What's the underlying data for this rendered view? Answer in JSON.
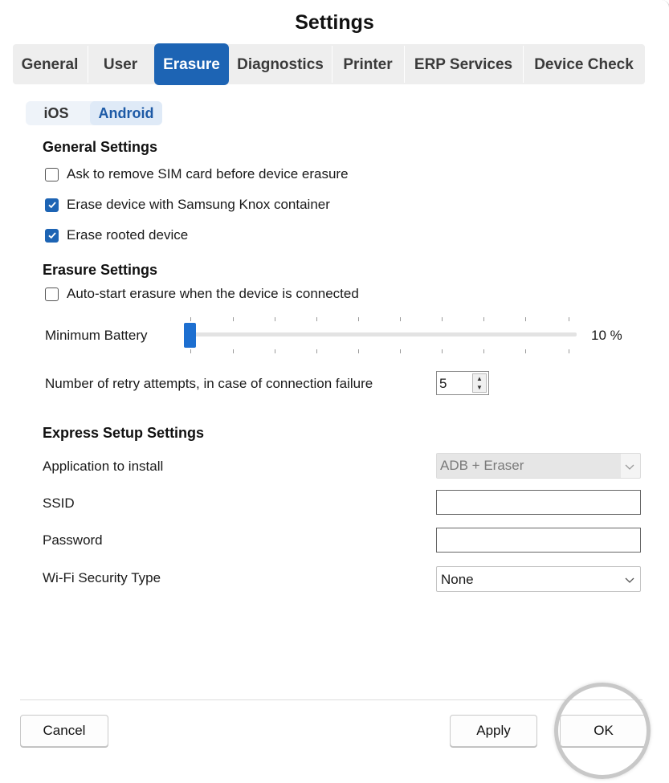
{
  "window": {
    "title": "Settings"
  },
  "tabs": [
    {
      "label": "General"
    },
    {
      "label": "User"
    },
    {
      "label": "Erasure",
      "active": true
    },
    {
      "label": "Diagnostics"
    },
    {
      "label": "Printer"
    },
    {
      "label": "ERP Services"
    },
    {
      "label": "Device Check"
    }
  ],
  "subtabs": [
    {
      "label": "iOS"
    },
    {
      "label": "Android",
      "active": true
    }
  ],
  "general_settings": {
    "title": "General Settings",
    "options": [
      {
        "label": "Ask to remove SIM card before device erasure",
        "checked": false
      },
      {
        "label": "Erase device with Samsung Knox container",
        "checked": true
      },
      {
        "label": "Erase rooted device",
        "checked": true
      }
    ]
  },
  "erasure_settings": {
    "title": "Erasure Settings",
    "auto_start": {
      "label": "Auto-start erasure when the device is connected",
      "checked": false
    },
    "min_battery": {
      "label": "Minimum Battery",
      "value_text": "10 %",
      "value_percent": 10
    },
    "retry": {
      "label": "Number of retry attempts, in case of connection failure",
      "value": "5"
    }
  },
  "express_setup": {
    "title": "Express Setup Settings",
    "application": {
      "label": "Application to install",
      "value": "ADB + Eraser",
      "disabled": true
    },
    "ssid": {
      "label": "SSID",
      "value": ""
    },
    "password": {
      "label": "Password",
      "value": ""
    },
    "wifi_security": {
      "label": "Wi-Fi Security Type",
      "value": "None"
    }
  },
  "buttons": {
    "cancel": "Cancel",
    "apply": "Apply",
    "ok": "OK"
  },
  "colors": {
    "accent": "#1d64b4",
    "slider_thumb": "#1d6fd0"
  }
}
